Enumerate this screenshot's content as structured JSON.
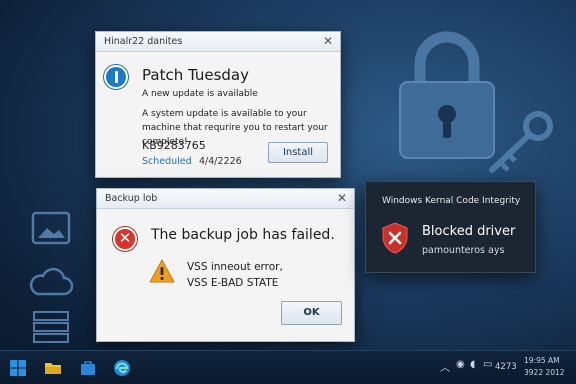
{
  "patch_window": {
    "title": "Hinalr22 danites",
    "heading": "Patch Tuesday",
    "subheading": "A new update is available",
    "message": "A system update is available to your machine that requrire you to restart your complete!",
    "kb": "KB9283765",
    "scheduled_label": "Scheduled",
    "scheduled_date": "4/4/2226",
    "install_label": "Install",
    "close_glyph": "✕"
  },
  "backup_window": {
    "title": "Backup lob",
    "heading": "The backup job has failed.",
    "error_line1": "VSS inneout error,",
    "error_line2": "VSS E-BAD STATE",
    "ok_label": "OK",
    "close_glyph": "✕"
  },
  "integrity_card": {
    "title": "Windows Kernal Code Integrity",
    "heading": "Blocked driver",
    "detail": "pamounteros ays"
  },
  "taskbar": {
    "icons": [
      "windows-start-icon",
      "file-explorer-icon",
      "store-icon",
      "edge-icon"
    ],
    "tray_number": "4273",
    "clock_time": "19:95 AM",
    "clock_date": "3922 2012"
  },
  "colors": {
    "accent_blue": "#1d79c9",
    "error_red": "#d9352b",
    "warning_orange": "#f0a020",
    "desktop_blue": "#1b3a5f"
  }
}
